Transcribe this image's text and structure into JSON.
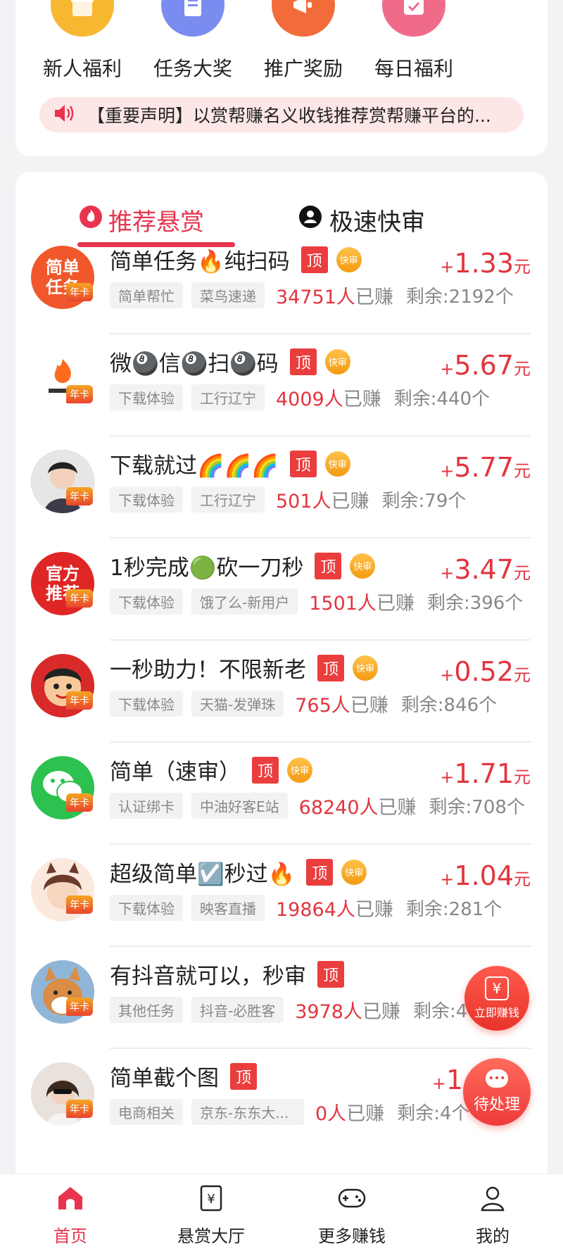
{
  "quick_links": [
    {
      "label": "新人福利",
      "icon": "gift-icon",
      "color": "#f7b731"
    },
    {
      "label": "任务大奖",
      "icon": "document-icon",
      "color": "#7b8cf0"
    },
    {
      "label": "推广奖励",
      "icon": "megaphone-icon",
      "color": "#f26b3a"
    },
    {
      "label": "每日福利",
      "icon": "calendar-check-icon",
      "color": "#f06b8a"
    }
  ],
  "notice": {
    "text": "【重要声明】以赏帮赚名义收钱推荐赏帮赚平台的..."
  },
  "tabs": [
    {
      "label": "推荐悬赏",
      "icon": "fire-icon",
      "active": true
    },
    {
      "label": "极速快审",
      "icon": "user-circle-icon",
      "active": false
    }
  ],
  "badges": {
    "top": "顶",
    "fast": "快审",
    "year": "年卡"
  },
  "tasks": [
    {
      "title": "简单任务🔥纯扫码",
      "tag1": "简单帮忙",
      "tag2": "菜鸟速递",
      "earned": "34751人",
      "earned_suffix": "已赚",
      "remain": "剩余:2192个",
      "plus": "+",
      "amount": "1.33",
      "unit": "元",
      "fast": true,
      "avatar_text": "简单任务",
      "avatar_color": "#f0582b"
    },
    {
      "title": "微🎱信🎱扫🎱码",
      "tag1": "下载体验",
      "tag2": "工行辽宁",
      "earned": "4009人",
      "earned_suffix": "已赚",
      "remain": "剩余:440个",
      "plus": "+",
      "amount": "5.67",
      "unit": "元",
      "fast": true,
      "avatar_text": "",
      "avatar_color": "#ffffff"
    },
    {
      "title": "下载就过🌈🌈🌈",
      "tag1": "下载体验",
      "tag2": "工行辽宁",
      "earned": "501人",
      "earned_suffix": "已赚",
      "remain": "剩余:79个",
      "plus": "+",
      "amount": "5.77",
      "unit": "元",
      "fast": true,
      "avatar_text": "",
      "avatar_color": "#5a6a7a"
    },
    {
      "title": "1秒完成🟢砍一刀秒",
      "tag1": "下载体验",
      "tag2": "饿了么-新用户",
      "earned": "1501人",
      "earned_suffix": "已赚",
      "remain": "剩余:396个",
      "plus": "+",
      "amount": "3.47",
      "unit": "元",
      "fast": true,
      "avatar_text": "官方推荐",
      "avatar_color": "#e02525"
    },
    {
      "title": "一秒助力！不限新老",
      "tag1": "下载体验",
      "tag2": "天猫-发弹珠",
      "earned": "765人",
      "earned_suffix": "已赚",
      "remain": "剩余:846个",
      "plus": "+",
      "amount": "0.52",
      "unit": "元",
      "fast": true,
      "avatar_text": "",
      "avatar_color": "#d92a2a"
    },
    {
      "title": "简单（速审）",
      "tag1": "认证绑卡",
      "tag2": "中油好客E站",
      "earned": "68240人",
      "earned_suffix": "已赚",
      "remain": "剩余:708个",
      "plus": "+",
      "amount": "1.71",
      "unit": "元",
      "fast": true,
      "avatar_text": "",
      "avatar_color": "#2dc14f"
    },
    {
      "title": "超级简单☑️秒过🔥",
      "tag1": "下载体验",
      "tag2": "映客直播",
      "earned": "19864人",
      "earned_suffix": "已赚",
      "remain": "剩余:281个",
      "plus": "+",
      "amount": "1.04",
      "unit": "元",
      "fast": true,
      "avatar_text": "",
      "avatar_color": "#f3d9c6"
    },
    {
      "title": "有抖音就可以，秒审",
      "tag1": "其他任务",
      "tag2": "抖音-必胜客",
      "earned": "3978人",
      "earned_suffix": "已赚",
      "remain": "剩余:403个",
      "plus": "+",
      "amount": "",
      "unit": "",
      "fast": false,
      "avatar_text": "",
      "avatar_color": "#c98a4b"
    },
    {
      "title": "简单截个图",
      "tag1": "电商相关",
      "tag2": "京东-东东大...",
      "earned": "0人",
      "earned_suffix": "已赚",
      "remain": "剩余:4个",
      "plus": "+",
      "amount": "1",
      "unit": "",
      "fast": false,
      "avatar_text": "",
      "avatar_color": "#d8c0b0"
    }
  ],
  "floating": {
    "earn_label": "立即赚钱",
    "pending_label": "待处理"
  },
  "bottom_nav": [
    {
      "label": "首页",
      "icon": "home-icon",
      "active": true
    },
    {
      "label": "悬赏大厅",
      "icon": "yuan-board-icon",
      "active": false
    },
    {
      "label": "更多赚钱",
      "icon": "gamepad-icon",
      "active": false
    },
    {
      "label": "我的",
      "icon": "user-icon",
      "active": false
    }
  ],
  "colors": {
    "accent": "#e8344f",
    "price": "#e2353f"
  }
}
